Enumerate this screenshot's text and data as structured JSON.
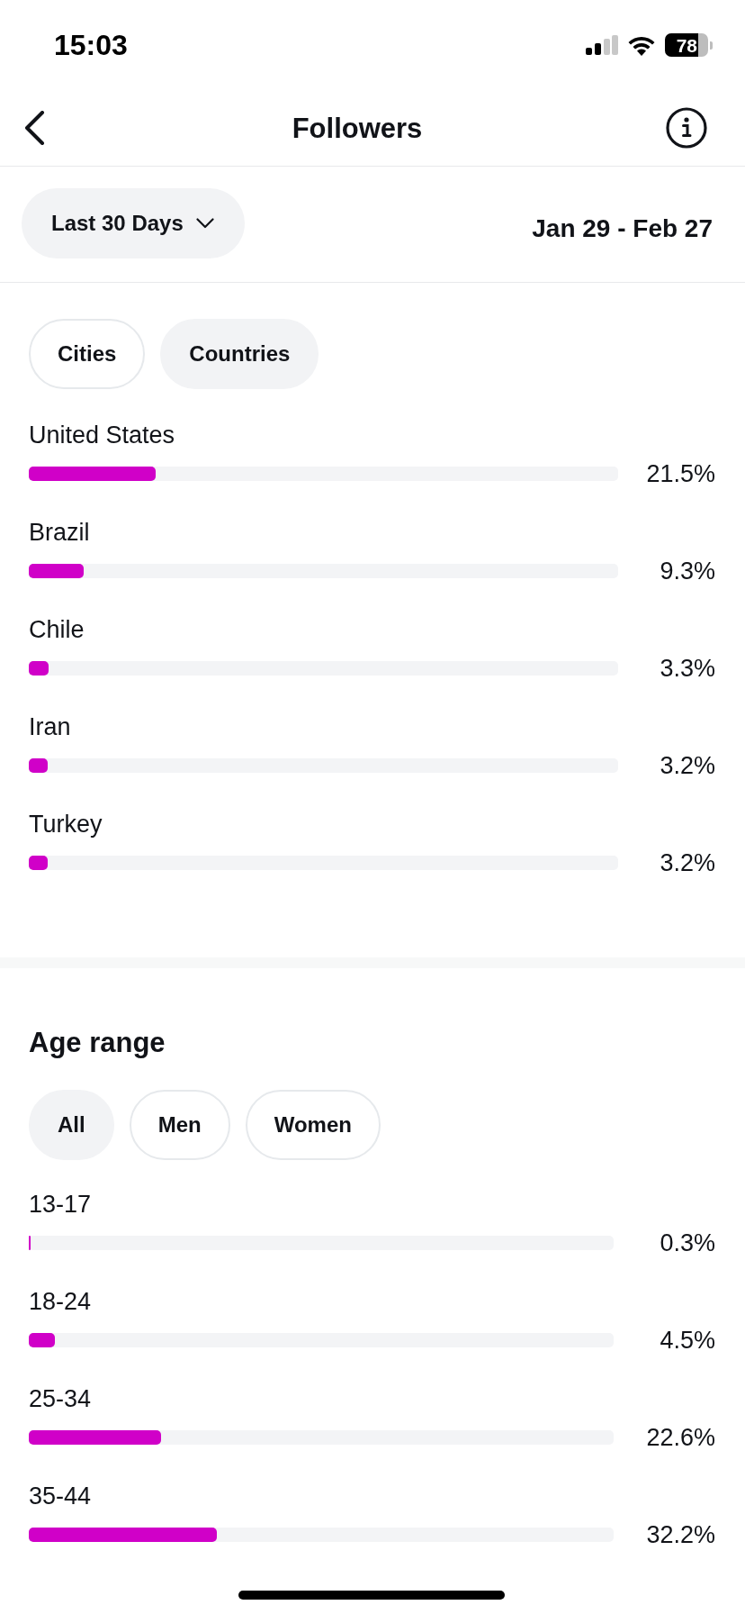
{
  "status_bar": {
    "time": "15:03",
    "battery": "78"
  },
  "header": {
    "title": "Followers"
  },
  "date_filter": {
    "range": "Last 30 Days",
    "dates": "Jan 29 - Feb 27"
  },
  "locations": {
    "tabs": [
      {
        "label": "Cities",
        "selected": false
      },
      {
        "label": "Countries",
        "selected": true
      }
    ],
    "rows": [
      {
        "name": "United States",
        "level": 0.215,
        "reading": "21.5%"
      },
      {
        "name": "Brazil",
        "level": 0.093,
        "reading": "9.3%"
      },
      {
        "name": "Chile",
        "level": 0.033,
        "reading": "3.3%"
      },
      {
        "name": "Iran",
        "level": 0.032,
        "reading": "3.2%"
      },
      {
        "name": "Turkey",
        "level": 0.032,
        "reading": "3.2%"
      }
    ]
  },
  "age_range": {
    "title": "Age range",
    "tabs": [
      {
        "label": "All",
        "selected": true
      },
      {
        "label": "Men",
        "selected": false
      },
      {
        "label": "Women",
        "selected": false
      }
    ],
    "rows": [
      {
        "name": "13-17",
        "level": 0.003,
        "reading": "0.3%"
      },
      {
        "name": "18-24",
        "level": 0.045,
        "reading": "4.5%"
      },
      {
        "name": "25-34",
        "level": 0.226,
        "reading": "22.6%"
      },
      {
        "name": "35-44",
        "level": 0.322,
        "reading": "32.2%"
      }
    ]
  }
}
